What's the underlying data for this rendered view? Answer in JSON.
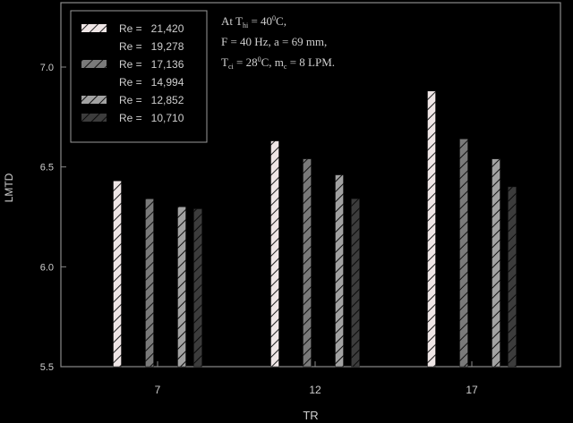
{
  "chart_data": {
    "type": "bar",
    "xlabel": "TR",
    "ylabel": "LMTD",
    "categories": [
      "7",
      "12",
      "17"
    ],
    "ylim": [
      5.5,
      7.3
    ],
    "yticks": [
      "5.5",
      "6.0",
      "6.5",
      "7.0"
    ],
    "series": [
      {
        "name": "Re =   21,420",
        "values": [
          6.43,
          6.63,
          6.88
        ],
        "color": "#e8e0e0"
      },
      {
        "name": "Re =   19,278",
        "values": [
          5.5,
          5.5,
          5.5
        ],
        "color": "#b8b8b8"
      },
      {
        "name": "Re =   17,136",
        "values": [
          6.34,
          6.54,
          6.64
        ],
        "color": "#777777"
      },
      {
        "name": "Re =   14,994",
        "values": [
          5.5,
          5.5,
          5.5
        ],
        "color": "#555555"
      },
      {
        "name": "Re =   12,852",
        "values": [
          6.3,
          6.46,
          6.54
        ],
        "color": "#9a9a9a"
      },
      {
        "name": "Re =   10,710",
        "values": [
          6.29,
          6.34,
          6.4
        ],
        "color": "#3a3a3a"
      }
    ],
    "annotations": [
      "At T",
      "hi",
      " = 40",
      "0",
      "C,",
      "F = 40 Hz, a = 69 mm,",
      "T",
      "ci",
      " = 28",
      "0",
      "C, m",
      "c",
      " = 8 LPM."
    ],
    "grid": false,
    "legend_position": "top-left"
  }
}
